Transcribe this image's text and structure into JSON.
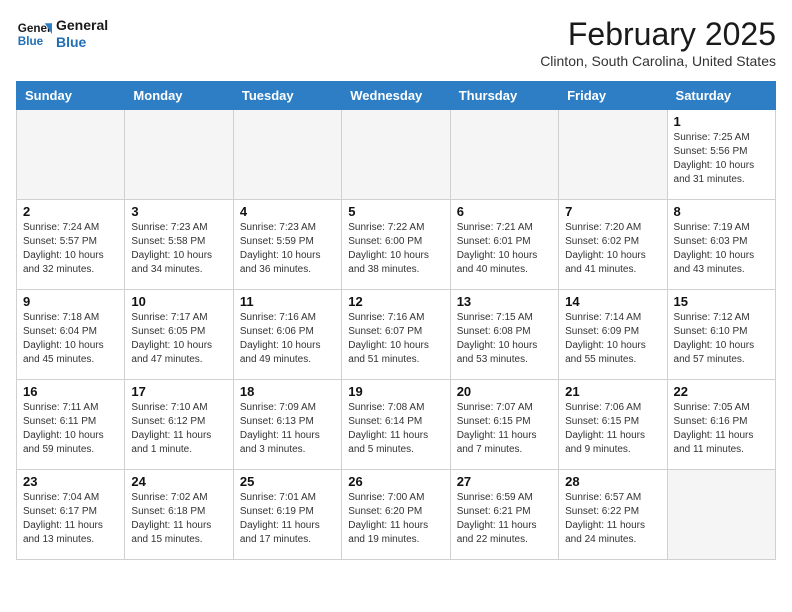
{
  "header": {
    "logo_line1": "General",
    "logo_line2": "Blue",
    "month_title": "February 2025",
    "location": "Clinton, South Carolina, United States"
  },
  "weekdays": [
    "Sunday",
    "Monday",
    "Tuesday",
    "Wednesday",
    "Thursday",
    "Friday",
    "Saturday"
  ],
  "weeks": [
    [
      {
        "day": "",
        "info": ""
      },
      {
        "day": "",
        "info": ""
      },
      {
        "day": "",
        "info": ""
      },
      {
        "day": "",
        "info": ""
      },
      {
        "day": "",
        "info": ""
      },
      {
        "day": "",
        "info": ""
      },
      {
        "day": "1",
        "info": "Sunrise: 7:25 AM\nSunset: 5:56 PM\nDaylight: 10 hours and 31 minutes."
      }
    ],
    [
      {
        "day": "2",
        "info": "Sunrise: 7:24 AM\nSunset: 5:57 PM\nDaylight: 10 hours and 32 minutes."
      },
      {
        "day": "3",
        "info": "Sunrise: 7:23 AM\nSunset: 5:58 PM\nDaylight: 10 hours and 34 minutes."
      },
      {
        "day": "4",
        "info": "Sunrise: 7:23 AM\nSunset: 5:59 PM\nDaylight: 10 hours and 36 minutes."
      },
      {
        "day": "5",
        "info": "Sunrise: 7:22 AM\nSunset: 6:00 PM\nDaylight: 10 hours and 38 minutes."
      },
      {
        "day": "6",
        "info": "Sunrise: 7:21 AM\nSunset: 6:01 PM\nDaylight: 10 hours and 40 minutes."
      },
      {
        "day": "7",
        "info": "Sunrise: 7:20 AM\nSunset: 6:02 PM\nDaylight: 10 hours and 41 minutes."
      },
      {
        "day": "8",
        "info": "Sunrise: 7:19 AM\nSunset: 6:03 PM\nDaylight: 10 hours and 43 minutes."
      }
    ],
    [
      {
        "day": "9",
        "info": "Sunrise: 7:18 AM\nSunset: 6:04 PM\nDaylight: 10 hours and 45 minutes."
      },
      {
        "day": "10",
        "info": "Sunrise: 7:17 AM\nSunset: 6:05 PM\nDaylight: 10 hours and 47 minutes."
      },
      {
        "day": "11",
        "info": "Sunrise: 7:16 AM\nSunset: 6:06 PM\nDaylight: 10 hours and 49 minutes."
      },
      {
        "day": "12",
        "info": "Sunrise: 7:16 AM\nSunset: 6:07 PM\nDaylight: 10 hours and 51 minutes."
      },
      {
        "day": "13",
        "info": "Sunrise: 7:15 AM\nSunset: 6:08 PM\nDaylight: 10 hours and 53 minutes."
      },
      {
        "day": "14",
        "info": "Sunrise: 7:14 AM\nSunset: 6:09 PM\nDaylight: 10 hours and 55 minutes."
      },
      {
        "day": "15",
        "info": "Sunrise: 7:12 AM\nSunset: 6:10 PM\nDaylight: 10 hours and 57 minutes."
      }
    ],
    [
      {
        "day": "16",
        "info": "Sunrise: 7:11 AM\nSunset: 6:11 PM\nDaylight: 10 hours and 59 minutes."
      },
      {
        "day": "17",
        "info": "Sunrise: 7:10 AM\nSunset: 6:12 PM\nDaylight: 11 hours and 1 minute."
      },
      {
        "day": "18",
        "info": "Sunrise: 7:09 AM\nSunset: 6:13 PM\nDaylight: 11 hours and 3 minutes."
      },
      {
        "day": "19",
        "info": "Sunrise: 7:08 AM\nSunset: 6:14 PM\nDaylight: 11 hours and 5 minutes."
      },
      {
        "day": "20",
        "info": "Sunrise: 7:07 AM\nSunset: 6:15 PM\nDaylight: 11 hours and 7 minutes."
      },
      {
        "day": "21",
        "info": "Sunrise: 7:06 AM\nSunset: 6:15 PM\nDaylight: 11 hours and 9 minutes."
      },
      {
        "day": "22",
        "info": "Sunrise: 7:05 AM\nSunset: 6:16 PM\nDaylight: 11 hours and 11 minutes."
      }
    ],
    [
      {
        "day": "23",
        "info": "Sunrise: 7:04 AM\nSunset: 6:17 PM\nDaylight: 11 hours and 13 minutes."
      },
      {
        "day": "24",
        "info": "Sunrise: 7:02 AM\nSunset: 6:18 PM\nDaylight: 11 hours and 15 minutes."
      },
      {
        "day": "25",
        "info": "Sunrise: 7:01 AM\nSunset: 6:19 PM\nDaylight: 11 hours and 17 minutes."
      },
      {
        "day": "26",
        "info": "Sunrise: 7:00 AM\nSunset: 6:20 PM\nDaylight: 11 hours and 19 minutes."
      },
      {
        "day": "27",
        "info": "Sunrise: 6:59 AM\nSunset: 6:21 PM\nDaylight: 11 hours and 22 minutes."
      },
      {
        "day": "28",
        "info": "Sunrise: 6:57 AM\nSunset: 6:22 PM\nDaylight: 11 hours and 24 minutes."
      },
      {
        "day": "",
        "info": ""
      }
    ]
  ]
}
